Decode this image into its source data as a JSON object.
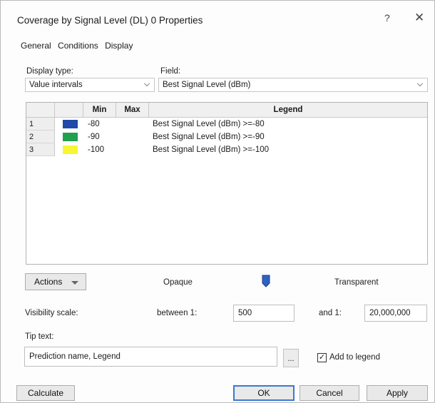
{
  "window": {
    "title": "Coverage by Signal Level (DL) 0 Properties",
    "help_label": "?",
    "close_label": "✕"
  },
  "tabs": [
    {
      "label": "General"
    },
    {
      "label": "Conditions"
    },
    {
      "label": "Display",
      "active": true
    }
  ],
  "display_type": {
    "label": "Display type:",
    "value": "Value intervals"
  },
  "field": {
    "label": "Field:",
    "value": "Best Signal Level (dBm)"
  },
  "table": {
    "columns": [
      "Min",
      "Max",
      "Legend"
    ],
    "rows": [
      {
        "num": "1",
        "color": "#1f4aa8",
        "min": "-80",
        "max": "",
        "legend": "Best Signal Level (dBm) >=-80"
      },
      {
        "num": "2",
        "color": "#21a050",
        "min": "-90",
        "max": "",
        "legend": "Best Signal Level (dBm) >=-90"
      },
      {
        "num": "3",
        "color": "#f6f632",
        "min": "-100",
        "max": "",
        "legend": "Best Signal Level (dBm) >=-100"
      }
    ]
  },
  "actions": {
    "label": "Actions"
  },
  "transparency": {
    "opaque_label": "Opaque",
    "transparent_label": "Transparent",
    "accent": "#2e63c2"
  },
  "visibility": {
    "label": "Visibility scale:",
    "between_label": "between 1:",
    "min_value": "500",
    "and_label": "and 1:",
    "max_value": "20,000,000"
  },
  "tip": {
    "label": "Tip text:",
    "value": "Prediction name, Legend",
    "browse_label": "...",
    "add_to_legend_label": "Add to legend",
    "add_to_legend_checked": true,
    "check_glyph": "✓"
  },
  "buttons": {
    "calculate": "Calculate",
    "ok": "OK",
    "cancel": "Cancel",
    "apply": "Apply"
  }
}
